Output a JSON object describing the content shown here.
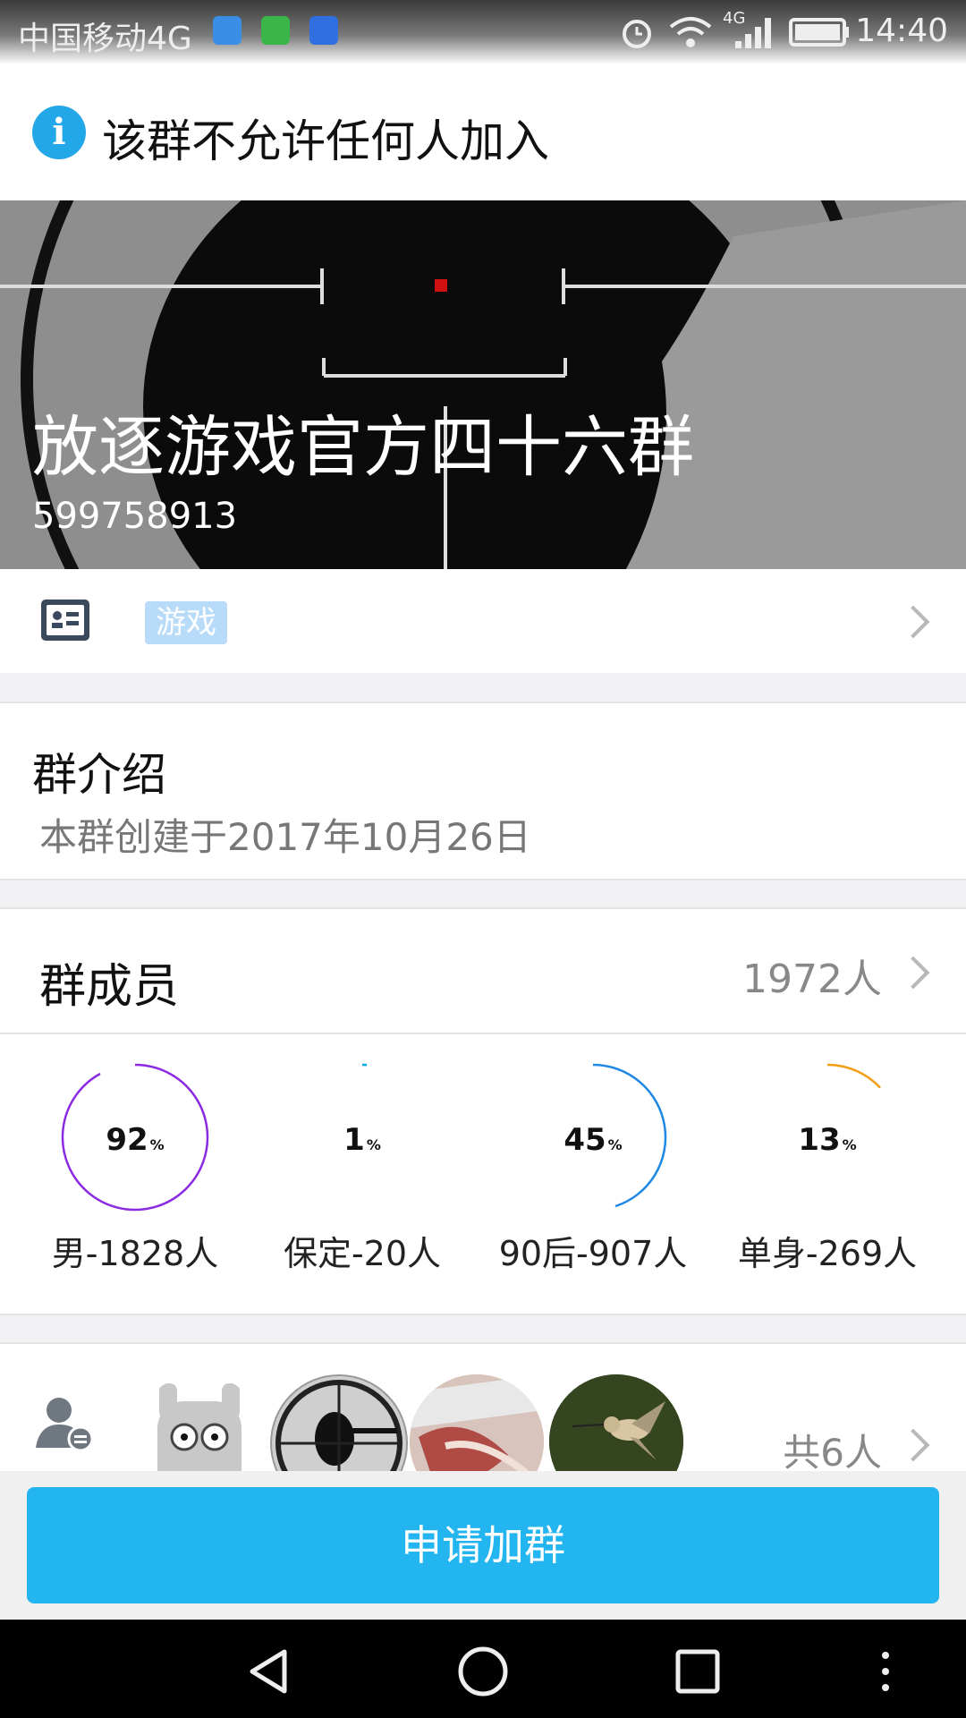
{
  "status_bar": {
    "carrier": "中国移动4G",
    "network": "4G",
    "time": "14:40",
    "icons": [
      "gallery-app-icon",
      "video-app-icon",
      "baidu-app-icon",
      "alarm-icon",
      "wifi-icon",
      "signal-icon",
      "battery-icon"
    ]
  },
  "notice": {
    "icon": "info-icon",
    "text": "该群不允许任何人加入"
  },
  "banner": {
    "group_name": "放逐游戏官方四十六群",
    "group_id": "599758913"
  },
  "tag_row": {
    "icon": "id-card-icon",
    "tag": "游戏"
  },
  "intro": {
    "title": "群介绍",
    "description": "本群创建于2017年10月26日"
  },
  "members": {
    "title": "群成员",
    "count": "1972人",
    "stats": [
      {
        "percent": 92,
        "percent_text": "92",
        "label": "男-1828人",
        "color": "#8a2be2"
      },
      {
        "percent": 1,
        "percent_text": "1",
        "label": "保定-20人",
        "color": "#00a8e8"
      },
      {
        "percent": 45,
        "percent_text": "45",
        "label": "90后-907人",
        "color": "#1e88e5"
      },
      {
        "percent": 13,
        "percent_text": "13",
        "label": "单身-269人",
        "color": "#f39c12"
      }
    ],
    "percent_sign": "%"
  },
  "admins": {
    "icon": "admin-icon",
    "total": "共6人"
  },
  "actions": {
    "join_label": "申请加群"
  },
  "colors": {
    "accent": "#22b5ef",
    "tag_bg": "#b7dbf9",
    "info_blue": "#22a7e8"
  }
}
